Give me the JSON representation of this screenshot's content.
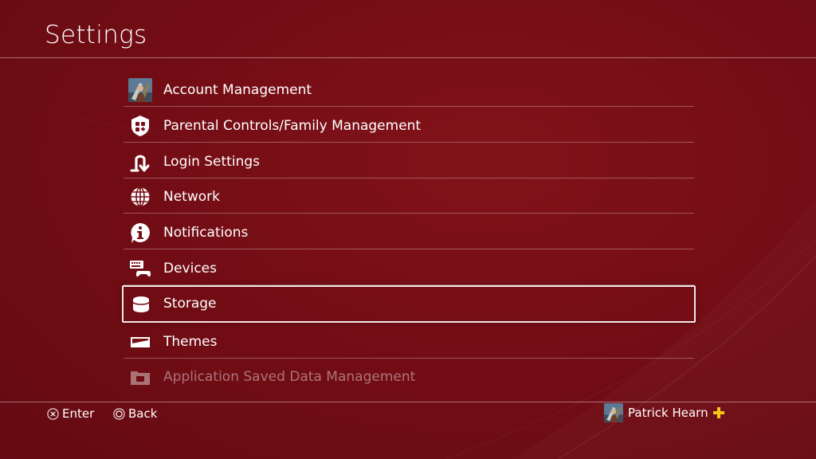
{
  "header": {
    "title": "Settings"
  },
  "menu": {
    "items": [
      {
        "label": "Account Management",
        "icon": "avatar-icon"
      },
      {
        "label": "Parental Controls/Family Management",
        "icon": "family-shield-icon"
      },
      {
        "label": "Login Settings",
        "icon": "login-icon"
      },
      {
        "label": "Network",
        "icon": "globe-icon"
      },
      {
        "label": "Notifications",
        "icon": "info-icon"
      },
      {
        "label": "Devices",
        "icon": "devices-icon"
      },
      {
        "label": "Storage",
        "icon": "storage-icon",
        "selected": true
      },
      {
        "label": "Themes",
        "icon": "themes-icon"
      },
      {
        "label": "Application Saved Data Management",
        "icon": "saved-data-folder-icon"
      }
    ]
  },
  "footer": {
    "enter_label": "Enter",
    "back_label": "Back",
    "user_name": "Patrick Hearn"
  },
  "colors": {
    "background": "#740d15",
    "selection_border": "#f2e8e8",
    "plus_accent": "#f5c518"
  }
}
